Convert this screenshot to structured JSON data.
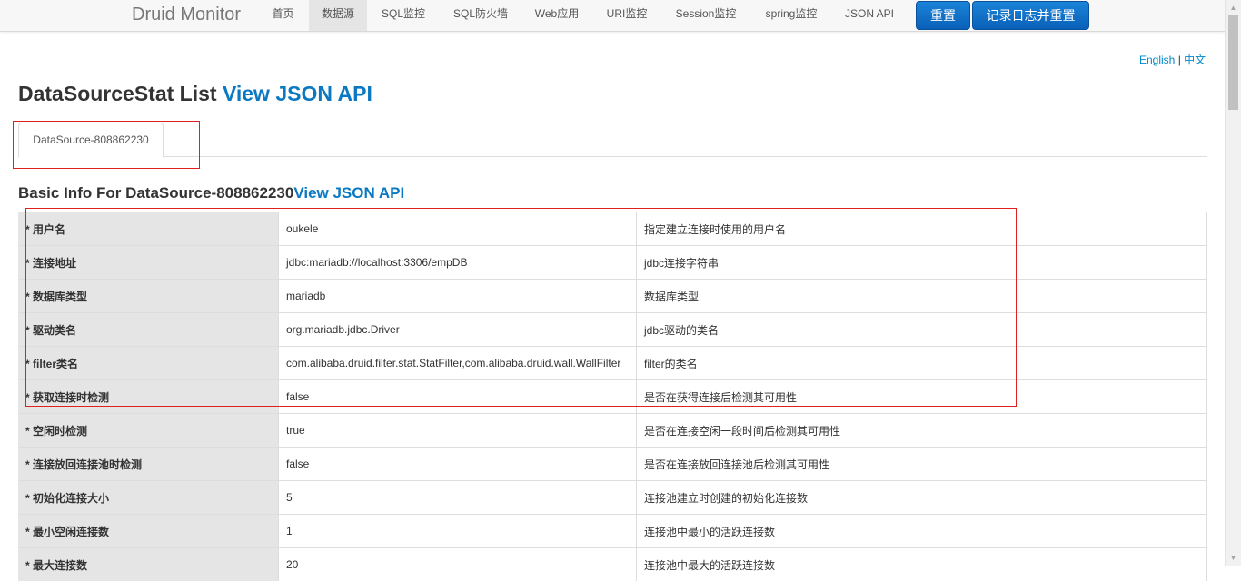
{
  "navbar": {
    "brand": "Druid Monitor",
    "items": [
      {
        "label": "首页"
      },
      {
        "label": "数据源"
      },
      {
        "label": "SQL监控"
      },
      {
        "label": "SQL防火墙"
      },
      {
        "label": "Web应用"
      },
      {
        "label": "URI监控"
      },
      {
        "label": "Session监控"
      },
      {
        "label": "spring监控"
      },
      {
        "label": "JSON API"
      }
    ],
    "active_index": 1,
    "reset_label": "重置",
    "log_reset_label": "记录日志并重置"
  },
  "lang": {
    "english": "English",
    "separator": "|",
    "chinese": "中文"
  },
  "page": {
    "title": "DataSourceStat List",
    "title_link": "View JSON API"
  },
  "tabs": [
    {
      "label": "DataSource-808862230"
    }
  ],
  "section": {
    "title": "Basic Info For DataSource-808862230",
    "title_link": "View JSON API"
  },
  "table": {
    "rows": [
      {
        "label": "* 用户名",
        "value": "oukele",
        "desc": "指定建立连接时使用的用户名"
      },
      {
        "label": "* 连接地址",
        "value": "jdbc:mariadb://localhost:3306/empDB",
        "desc": "jdbc连接字符串"
      },
      {
        "label": "* 数据库类型",
        "value": "mariadb",
        "desc": "数据库类型"
      },
      {
        "label": "* 驱动类名",
        "value": "org.mariadb.jdbc.Driver",
        "desc": "jdbc驱动的类名"
      },
      {
        "label": "* filter类名",
        "value": "com.alibaba.druid.filter.stat.StatFilter,com.alibaba.druid.wall.WallFilter",
        "desc": "filter的类名"
      },
      {
        "label": "* 获取连接时检测",
        "value": "false",
        "desc": "是否在获得连接后检测其可用性"
      },
      {
        "label": "* 空闲时检测",
        "value": "true",
        "desc": "是否在连接空闲一段时间后检测其可用性"
      },
      {
        "label": "* 连接放回连接池时检测",
        "value": "false",
        "desc": "是否在连接放回连接池后检测其可用性"
      },
      {
        "label": "* 初始化连接大小",
        "value": "5",
        "desc": "连接池建立时创建的初始化连接数"
      },
      {
        "label": "* 最小空闲连接数",
        "value": "1",
        "desc": "连接池中最小的活跃连接数"
      },
      {
        "label": "* 最大连接数",
        "value": "20",
        "desc": "连接池中最大的活跃连接数"
      }
    ]
  },
  "colors": {
    "link": "#0a79c2",
    "primary_button": "#0a60b8",
    "highlight_box": "#e02020",
    "label_bg": "#e5e5e5"
  }
}
